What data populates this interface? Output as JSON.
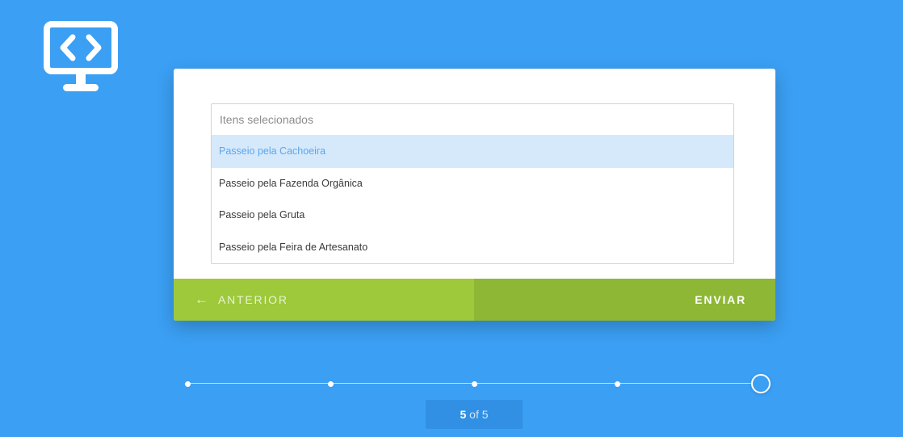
{
  "logo": {
    "icon": "code-monitor-icon"
  },
  "select": {
    "header": "Itens selecionados",
    "options": [
      {
        "label": "Passeio pela Cachoeira",
        "selected": true
      },
      {
        "label": "Passeio pela Fazenda Orgânica",
        "selected": false
      },
      {
        "label": "Passeio pela Gruta",
        "selected": false
      },
      {
        "label": "Passeio pela Feira de Artesanato",
        "selected": false
      }
    ]
  },
  "footer": {
    "prev_icon": "arrow-left-icon",
    "prev_label": "ANTERIOR",
    "send_label": "ENVIAR"
  },
  "progress": {
    "steps": 5,
    "current_step": 5
  },
  "counter": {
    "current": "5",
    "of_text": "of 5"
  },
  "colors": {
    "background": "#3b9ff3",
    "prev_button": "#9dc93a",
    "send_button": "#8eb735",
    "selected_option_bg": "#d6e9fb",
    "selected_option_text": "#5aa7ee"
  }
}
